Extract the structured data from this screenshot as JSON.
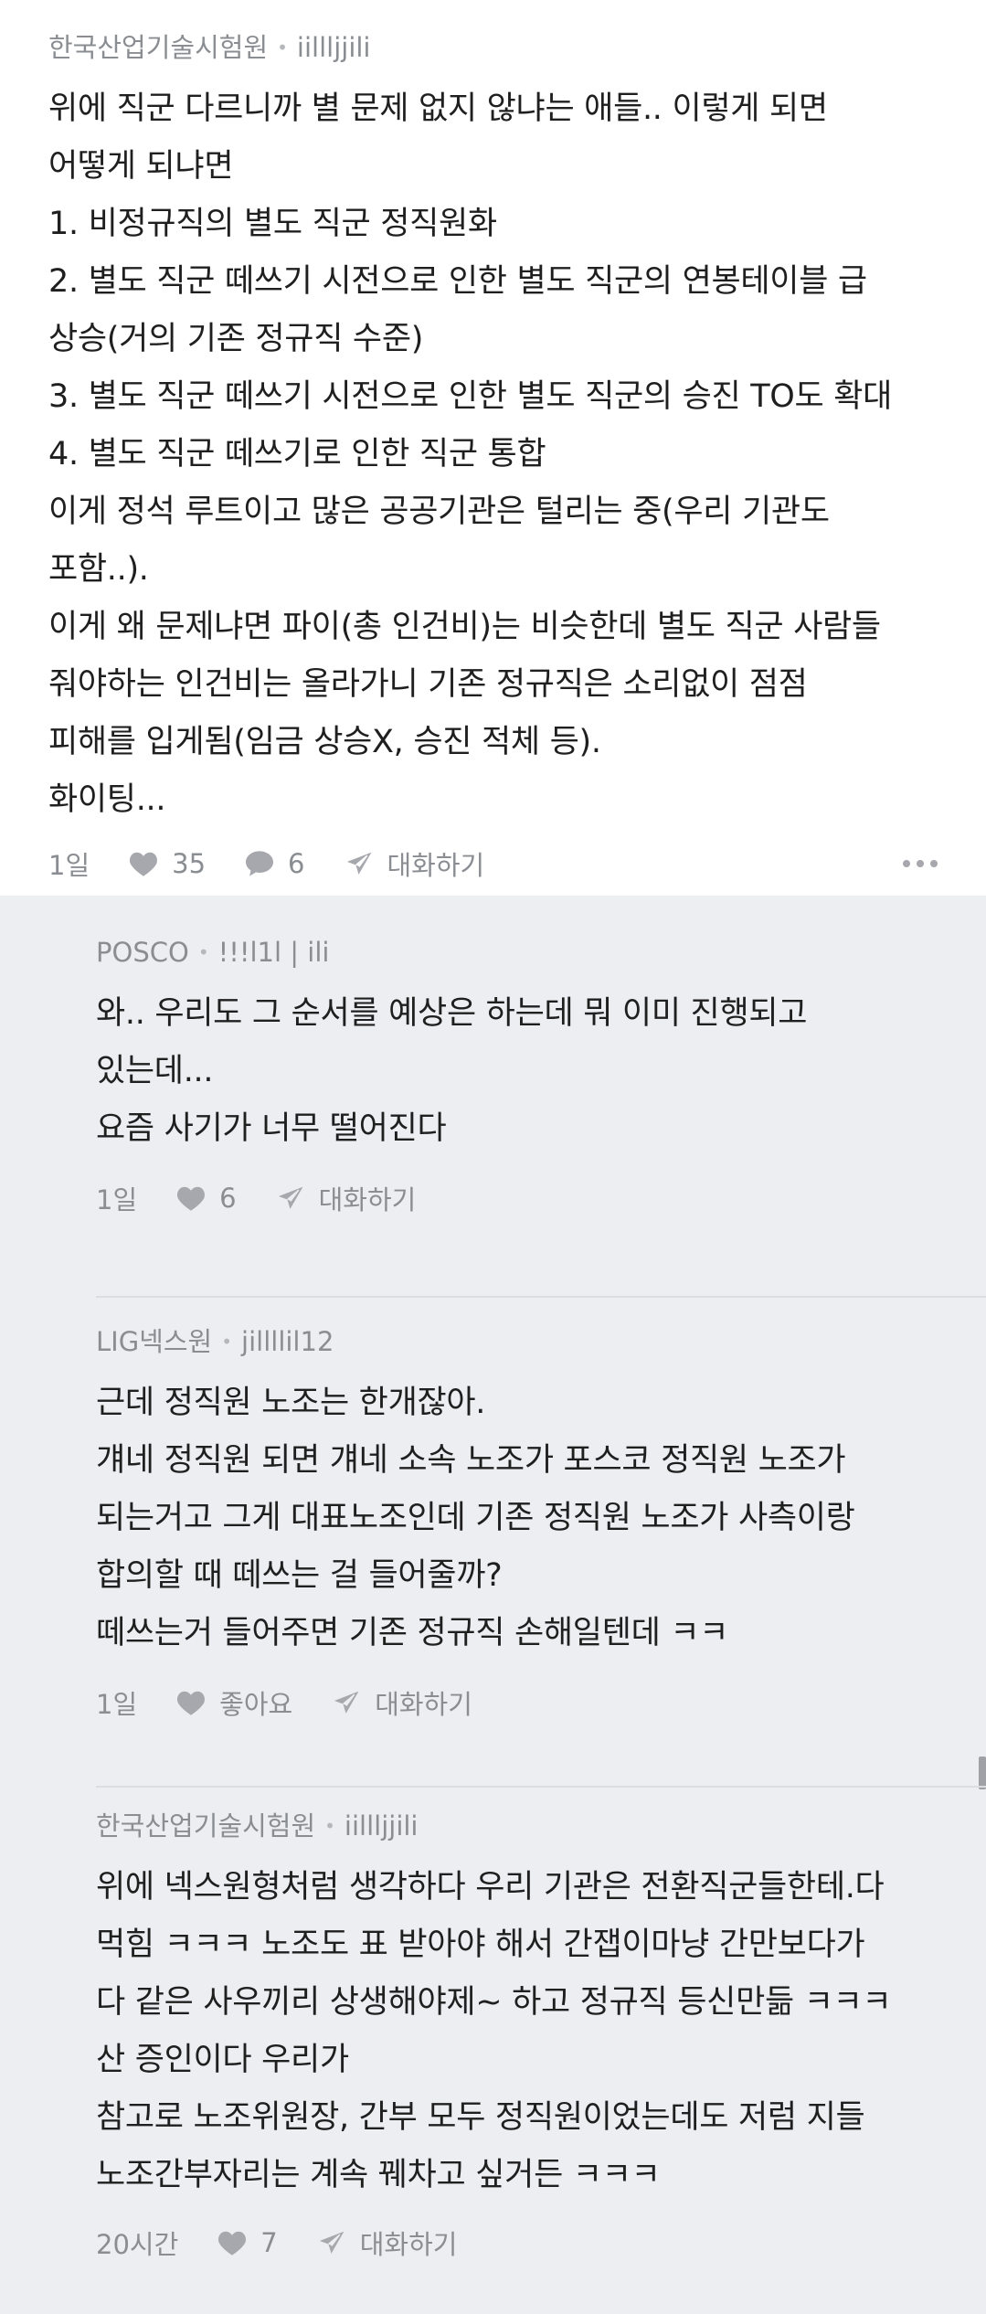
{
  "main": {
    "author": "한국산업기술시험원",
    "nickname": "iillljjili",
    "lines": [
      "위에 직군 다르니까 별 문제 없지 않냐는 애들.. 이렇게 되면",
      "어떻게 되냐면",
      "1. 비정규직의 별도 직군 정직원화",
      "2. 별도 직군 떼쓰기 시전으로 인한 별도 직군의 연봉테이블 급",
      "상승(거의 기존 정규직 수준)",
      "3. 별도 직군 떼쓰기 시전으로 인한 별도 직군의 승진 TO도 확대",
      "4. 별도 직군 떼쓰기로 인한 직군 통합",
      "이게 정석 루트이고 많은 공공기관은 털리는 중(우리 기관도",
      "포함..).",
      "이게 왜 문제냐면 파이(총 인건비)는 비슷한데 별도 직군 사람들",
      "줘야하는 인건비는 올라가니 기존 정규직은 소리없이 점점",
      "피해를 입게됨(임금 상승X, 승진 적체 등).",
      "화이팅..."
    ],
    "time": "1일",
    "likes": "35",
    "comments": "6",
    "chat_label": "대화하기"
  },
  "replies": [
    {
      "author": "POSCO",
      "nickname": "!!!l1l | ili",
      "lines": [
        "와.. 우리도 그 순서를 예상은 하는데 뭐 이미 진행되고",
        "있는데...",
        "요즘 사기가 너무 떨어진다"
      ],
      "time": "1일",
      "likes": "6",
      "chat_label": "대화하기"
    },
    {
      "author": "LIG넥스원",
      "nickname": "jillllil12",
      "lines": [
        "근데 정직원 노조는 한개잖아.",
        "걔네 정직원 되면 걔네 소속 노조가 포스코 정직원 노조가",
        "되는거고 그게 대표노조인데 기존 정직원 노조가 사측이랑",
        "합의할 때 떼쓰는 걸 들어줄까?",
        "떼쓰는거 들어주면 기존 정규직 손해일텐데 ㅋㅋ"
      ],
      "time": "1일",
      "likes": "좋아요",
      "chat_label": "대화하기"
    },
    {
      "author": "한국산업기술시험원",
      "nickname": "iillljjili",
      "lines": [
        "위에 넥스원형처럼 생각하다 우리 기관은 전환직군들한테.다",
        "먹힘 ㅋㅋㅋ 노조도 표 받아야 해서 간잽이마냥 간만보다가",
        "다 같은 사우끼리 상생해야제~ 하고 정규직 등신만듦 ㅋㅋㅋ",
        "산 증인이다 우리가",
        "참고로 노조위원장, 간부 모두 정직원이었는데도 저럼 지들",
        "노조간부자리는 계속 꿰차고 싶거든 ㅋㅋㅋ"
      ],
      "time": "20시간",
      "likes": "7",
      "chat_label": "대화하기"
    }
  ]
}
